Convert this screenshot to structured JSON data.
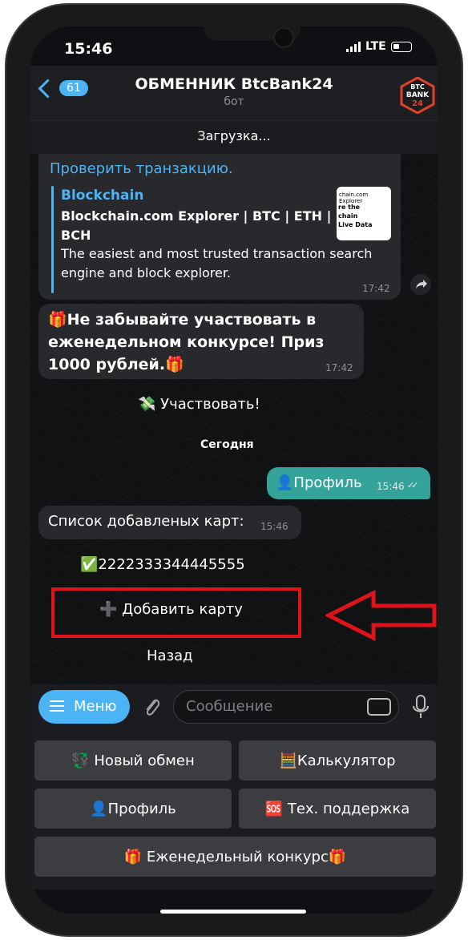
{
  "status": {
    "time": "15:46",
    "network": "LTE"
  },
  "header": {
    "back_count": "61",
    "title": "ОБМЕННИК BtcBank24",
    "subtitle": "бот",
    "avatar_text_top": "BTC",
    "avatar_text_mid": "BANK",
    "avatar_text_bottom": "24"
  },
  "loading": "Загрузка...",
  "messages": {
    "link_text": "Проверить транзакцию.",
    "preview": {
      "site": "Blockchain",
      "title": "Blockchain.com Explorer | BTC | ETH | BCH",
      "description": "The easiest and most trusted transaction search engine and block explorer.",
      "thumb_line1": "chain.com Explorer",
      "thumb_line2": "re the\nchain\nLive Data",
      "time": "17:42"
    },
    "contest_msg": {
      "text": "🎁Не забывайте участвовать в еженедельном конкурсе! Приз 1000 рублей.🎁",
      "time": "17:42"
    },
    "participate_button": "💸 Участвовать!",
    "date_chip": "Сегодня",
    "profile_out": {
      "text": "👤Профиль",
      "time": "15:46"
    },
    "cards_msg": {
      "text": "Список добавленых карт:",
      "time": "15:46"
    },
    "card_button": "✅2222333344445555",
    "add_card_button": "➕ Добавить карту",
    "back_button": "Назад"
  },
  "input": {
    "menu_label": "Меню",
    "placeholder": "Сообщение"
  },
  "keyboard": {
    "new_exchange": "💱 Новый обмен",
    "calculator": "🧮Калькулятор",
    "profile": "👤Профиль",
    "support": "🆘 Тех. поддержка",
    "contest": "🎁 Еженедельный конкурс🎁"
  },
  "colors": {
    "accent": "#4cb3f5",
    "outgoing": "#36a39a",
    "highlight": "#e0121a"
  }
}
